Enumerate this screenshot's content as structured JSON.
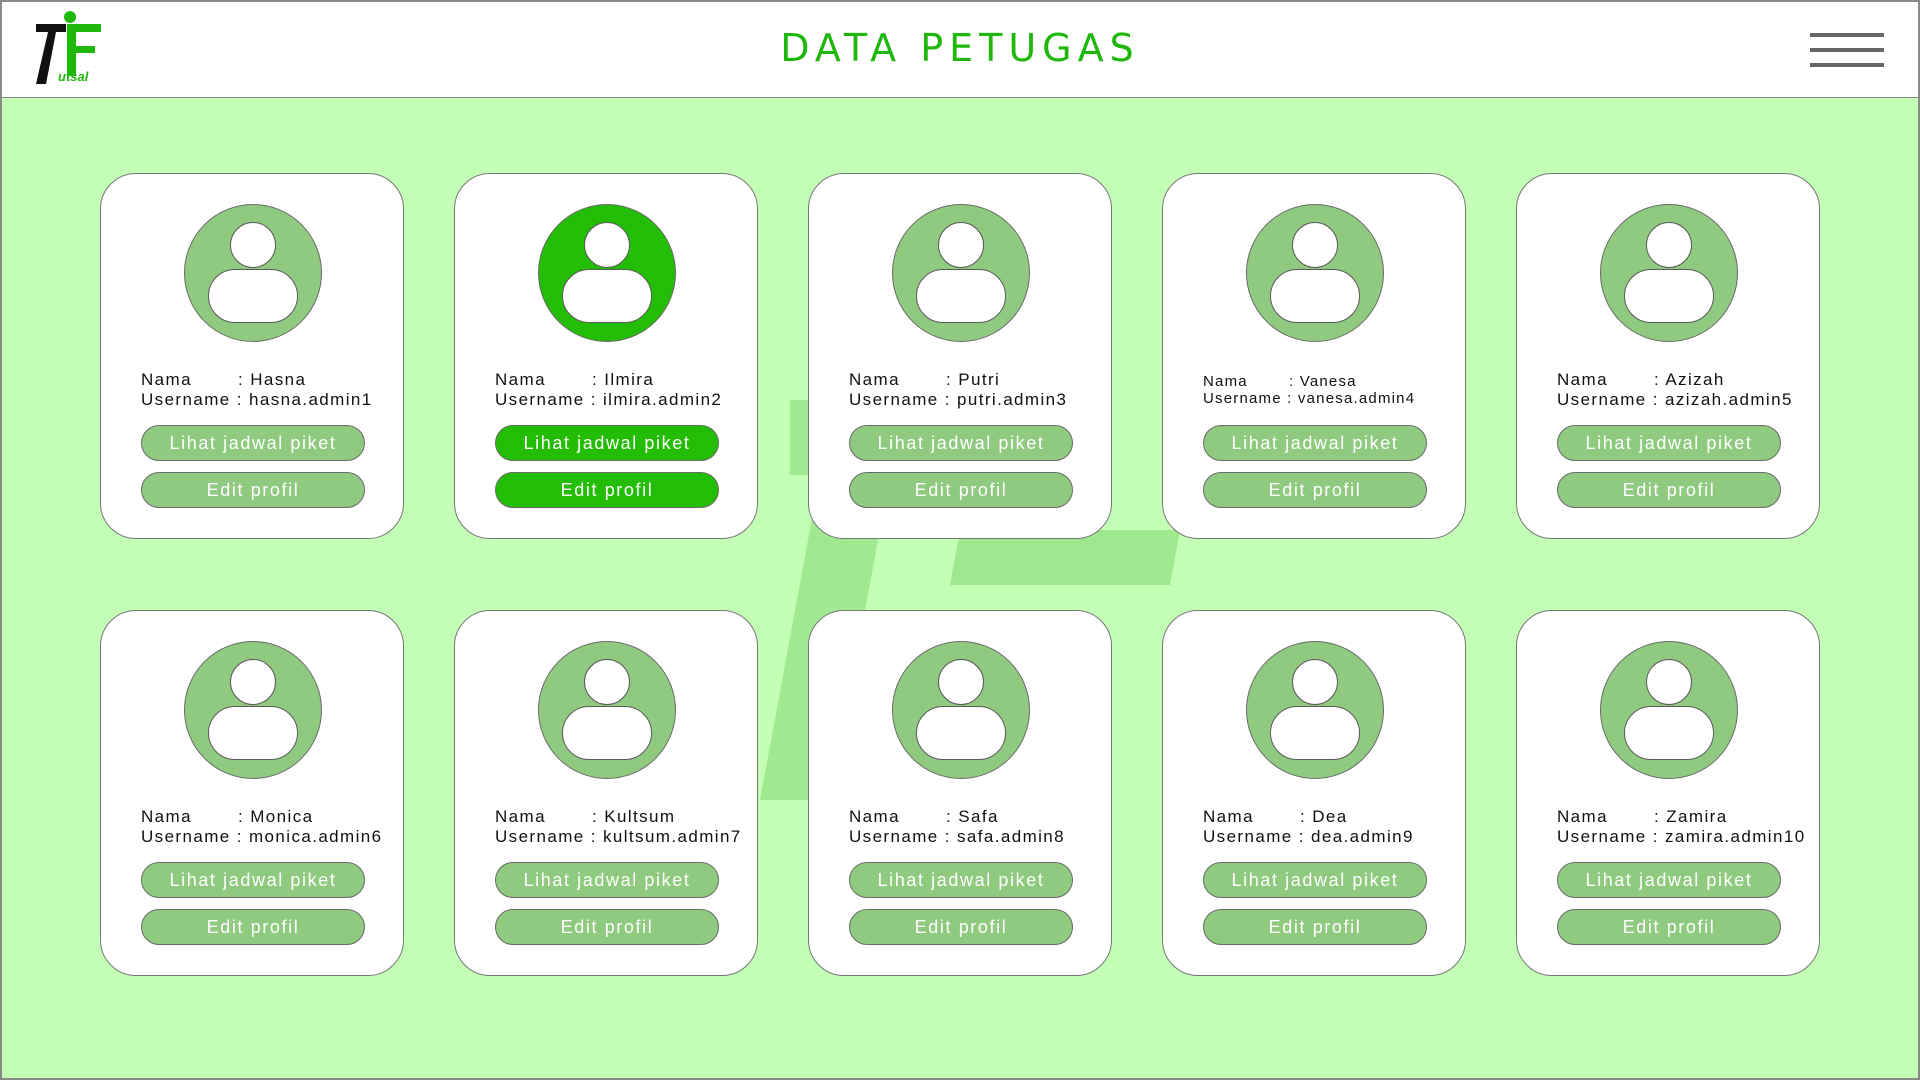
{
  "header": {
    "title": "DATA PETUGAS",
    "logo_numeral": "7",
    "logo_letter": "F",
    "logo_word": "utsal",
    "menu_icon": "hamburger-menu-icon"
  },
  "labels": {
    "nama": "Nama",
    "username": "Username",
    "separator": ":",
    "lihat_jadwal": "Lihat jadwal piket",
    "edit_profil": "Edit profil"
  },
  "colors": {
    "background": "#c3ffb5",
    "accent_green": "#1fb80a",
    "active_green": "#24bd05",
    "muted_green": "#8fca80",
    "menu_gray": "#666666"
  },
  "officers": [
    {
      "nama": "Hasna",
      "username": "hasna.admin1",
      "active": false
    },
    {
      "nama": "Ilmira",
      "username": "ilmira.admin2",
      "active": true
    },
    {
      "nama": "Putri",
      "username": "putri.admin3",
      "active": false
    },
    {
      "nama": "Vanesa",
      "username": "vanesa.admin4",
      "active": false
    },
    {
      "nama": "Azizah",
      "username": "azizah.admin5",
      "active": false
    },
    {
      "nama": "Monica",
      "username": "monica.admin6",
      "active": false
    },
    {
      "nama": "Kultsum",
      "username": "kultsum.admin7",
      "active": false
    },
    {
      "nama": "Safa",
      "username": "safa.admin8",
      "active": false
    },
    {
      "nama": "Dea",
      "username": "dea.admin9",
      "active": false
    },
    {
      "nama": "Zamira",
      "username": "zamira.admin10",
      "active": false
    }
  ]
}
